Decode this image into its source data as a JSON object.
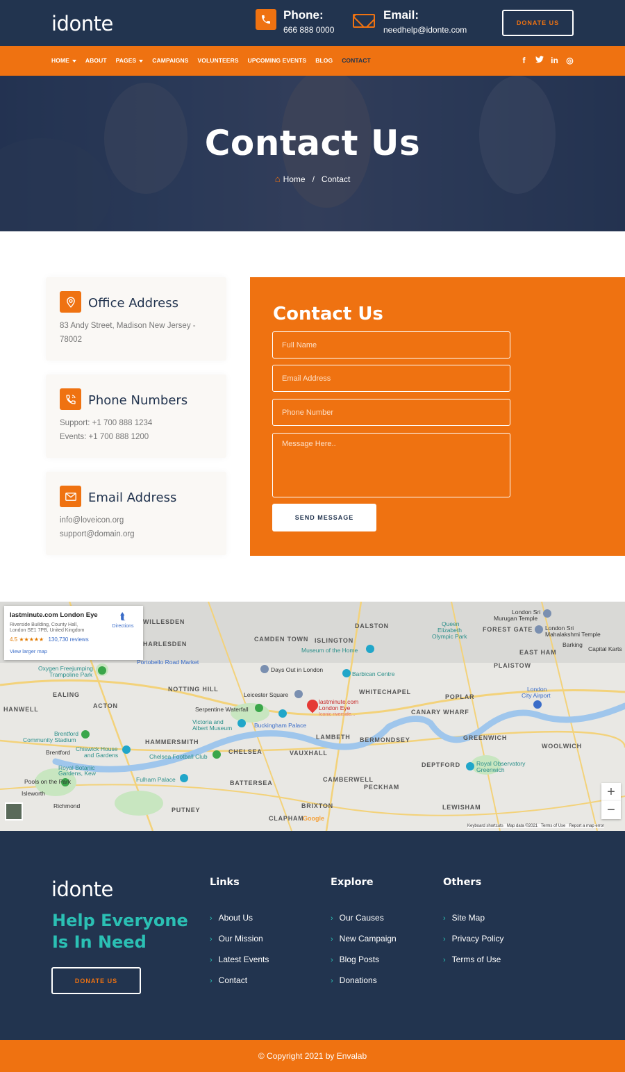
{
  "brand": {
    "logo": "idonte"
  },
  "header": {
    "phone_title": "Phone:",
    "phone_value": "666 888 0000",
    "email_title": "Email:",
    "email_value": "needhelp@idonte.com",
    "donate": "DONATE US"
  },
  "nav": {
    "items": [
      {
        "label": "HOME"
      },
      {
        "label": "ABOUT"
      },
      {
        "label": "PAGES"
      },
      {
        "label": "CAMPAIGNS"
      },
      {
        "label": "VOLUNTEERS"
      },
      {
        "label": "UPCOMING EVENTS"
      },
      {
        "label": "BLOG"
      },
      {
        "label": "CONTACT"
      }
    ],
    "social": {
      "facebook": "f",
      "twitter": "t",
      "linkedin": "in",
      "instagram": "◎"
    }
  },
  "hero": {
    "title": "Contact Us",
    "breadcrumb_home": "Home",
    "breadcrumb_sep": "/",
    "breadcrumb_current": "Contact"
  },
  "cards": {
    "office": {
      "title": "Office Address",
      "line1": "83 Andy Street, Madison New Jersey -",
      "line2": "78002"
    },
    "phone": {
      "title": "Phone Numbers",
      "line1": "Support: +1 700 888 1234",
      "line2": "Events: +1 700 888 1200"
    },
    "email": {
      "title": "Email Address",
      "line1": "info@loveicon.org",
      "line2": "support@domain.org"
    }
  },
  "form": {
    "title": "Contact Us",
    "name_placeholder": "Full Name",
    "email_placeholder": "Email Address",
    "phone_placeholder": "Phone Number",
    "message_placeholder": "Message Here..",
    "send": "SEND MESSAGE"
  },
  "map": {
    "card_title": "lastminute.com London Eye",
    "card_addr1": "Riverside Building, County Hall,",
    "card_addr2": "London SE1 7PB, United Kingdom",
    "rating": "4.5",
    "stars": "★★★★★",
    "reviews": "130,730 reviews",
    "view_larger": "View larger map",
    "directions": "Directions",
    "marker_label": "lastminute.com",
    "marker_label2": "London Eye",
    "marker_sub": "Iconic riverside...",
    "places": [
      "WILLESDEN",
      "HARLESDEN",
      "DALSTON",
      "ISLINGTON",
      "CAMDEN TOWN",
      "NOTTING HILL",
      "WHITECHAPEL",
      "POPLAR",
      "EALING",
      "ACTON",
      "HANWELL",
      "HAMMERSMITH",
      "CHELSEA",
      "VAUXHALL",
      "LAMBETH",
      "BERMONDSEY",
      "CANARY WHARF",
      "GREENWICH",
      "WOOLWICH",
      "DEPTFORD",
      "BATTERSEA",
      "CAMBERWELL",
      "PECKHAM",
      "PUTNEY",
      "BRIXTON",
      "CLAPHAM",
      "LEWISHAM",
      "EAST HAM",
      "PLAISTOW",
      "FOREST GATE"
    ],
    "pois": {
      "days_out": "Days Out in London",
      "barbican": "Barbican Centre",
      "leicester": "Leicester Square",
      "serpentine": "Serpentine Waterfall",
      "va1": "Victoria and",
      "va2": "Albert Museum",
      "buckingham": "Buckingham Palace",
      "oxygen1": "Oxygen Freejumping",
      "oxygen2": "Trampoline Park",
      "portobello": "Portobello Road Market",
      "museum_home": "Museum of the Home",
      "queen1": "Queen",
      "queen2": "Elizabeth",
      "queen3": "Olympic Park",
      "murugan1": "London Sri",
      "murugan2": "Murugan Temple",
      "maha1": "London Sri",
      "maha2": "Mahalakshmi Temple",
      "brentford1": "Brentford",
      "brentford2": "Community Stadium",
      "chiswick1": "Chiswick House",
      "chiswick2": "and Gardens",
      "kew1": "Royal Botanic",
      "kew2": "Gardens, Kew",
      "chelsea_fc": "Chelsea Football Club",
      "fulham": "Fulham Palace",
      "pools": "Pools on the Park",
      "city_airport1": "London",
      "city_airport2": "City Airport",
      "observatory1": "Royal Observatory",
      "observatory2": "Greenwich",
      "isleworth": "Isleworth",
      "richmond": "Richmond",
      "brentford": "Brentford",
      "barking": "Barking",
      "capital_karts": "Capital Karts"
    },
    "attribution": "Keyboard shortcuts   Map data ©2021   Terms of Use   Report a map error",
    "google": "Google",
    "zoom_in": "+",
    "zoom_out": "−"
  },
  "footer": {
    "logo": "idonte",
    "tagline1": "Help Everyone",
    "tagline2": "Is In Need",
    "donate": "DONATE US",
    "links_title": "Links",
    "links": [
      "About Us",
      "Our Mission",
      "Latest Events",
      "Contact"
    ],
    "explore_title": "Explore",
    "explore": [
      "Our Causes",
      "New Campaign",
      "Blog Posts",
      "Donations"
    ],
    "others_title": "Others",
    "others": [
      "Site Map",
      "Privacy Policy",
      "Terms of Use"
    ],
    "copyright": "© Copyright 2021 by Envalab"
  },
  "colors": {
    "navy": "#22344f",
    "orange": "#ef7211",
    "teal": "#2bc0b4"
  }
}
